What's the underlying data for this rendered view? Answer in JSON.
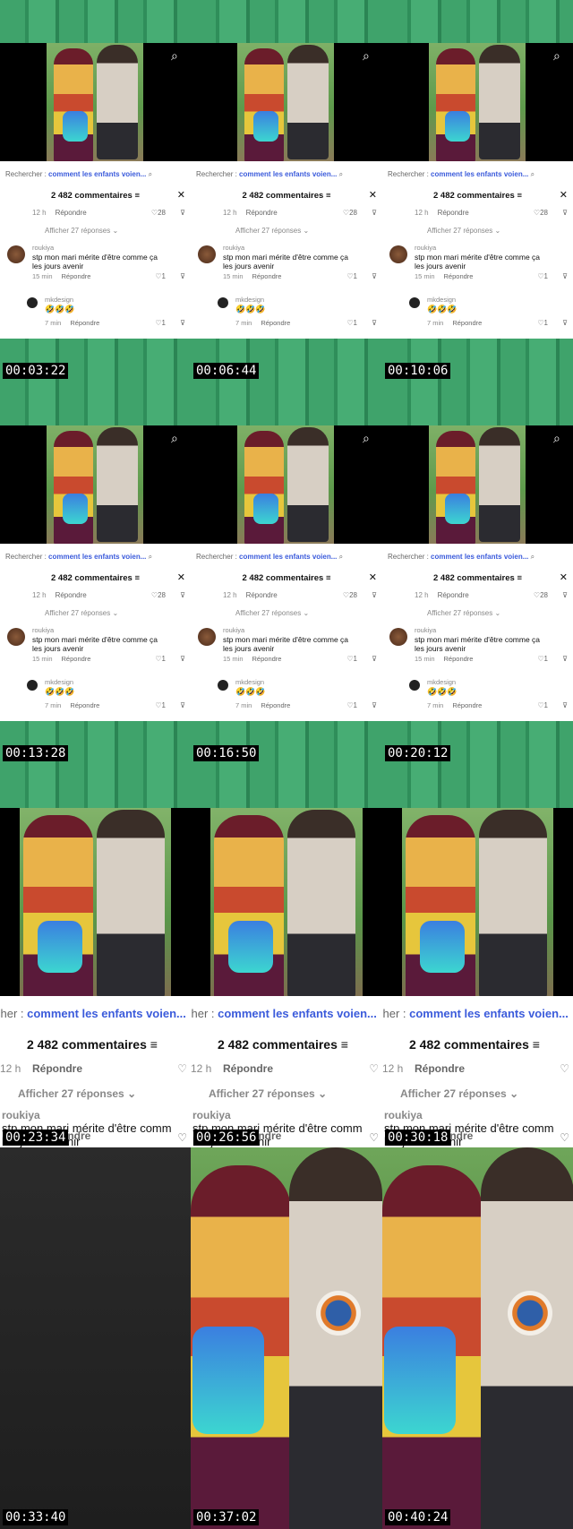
{
  "panel": {
    "search_prefix": "Rechercher :",
    "search_query": "comment les enfants voien...",
    "comments_title": "2 482 commentaires",
    "first_time": "12 h",
    "reply": "Répondre",
    "first_likes": "28",
    "more_replies": "Afficher 27 réponses",
    "user1": "roukiya",
    "comment1": "stp mon mari mérite d'être comme ça les jours avenir",
    "time1": "15 min",
    "likes1": "1",
    "user2": "mkdesign",
    "comment2": "🤣🤣🤣",
    "time2": "7 min",
    "likes2": "1"
  },
  "zoom": {
    "search_prefix": "cher :",
    "search_query": "comment les enfants voien...",
    "comments_title": "2 482 commentaires",
    "time": "12 h",
    "reply": "Répondre",
    "more_replies": "Afficher 27 réponses",
    "user": "roukiya",
    "comment_l1": "stp mon mari mérite d'être comm",
    "comment_l2": "les jours avenir",
    "reply_partial": "ondre"
  },
  "timestamps": {
    "t1": "00:03:22",
    "t2": "00:06:44",
    "t3": "00:10:06",
    "t4": "00:13:28",
    "t5": "00:16:50",
    "t6": "00:20:12",
    "t7": "00:23:34",
    "t8": "00:26:56",
    "t9": "00:30:18",
    "t10": "00:33:40",
    "t11": "00:37:02",
    "t12": "00:40:24"
  },
  "icons": {
    "search": "search-icon",
    "close": "close-icon",
    "heart": "heart-icon",
    "dislike": "dislike-icon",
    "filter": "filter-icon"
  }
}
